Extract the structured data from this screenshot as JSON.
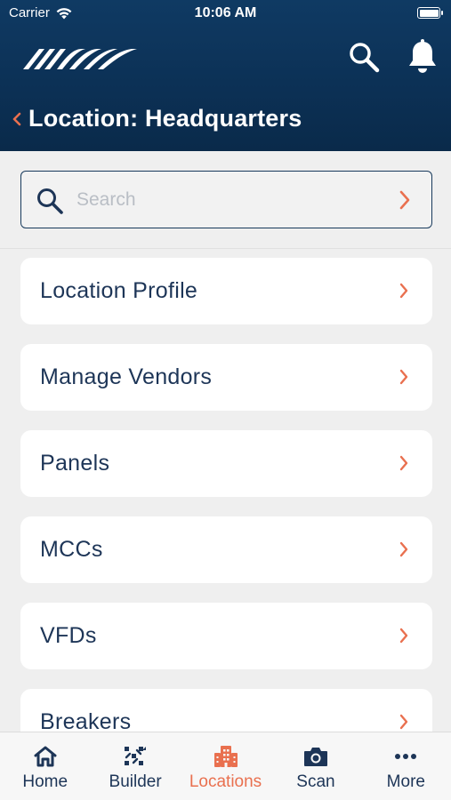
{
  "status_bar": {
    "carrier": "Carrier",
    "time": "10:06 AM"
  },
  "header": {
    "title": "Location: Headquarters",
    "icons": [
      "logo-icon",
      "search-icon",
      "bell-icon",
      "back-chevron-icon"
    ]
  },
  "search": {
    "placeholder": "Search",
    "value": ""
  },
  "menu": {
    "items": [
      {
        "label": "Location Profile"
      },
      {
        "label": "Manage Vendors"
      },
      {
        "label": "Panels"
      },
      {
        "label": "MCCs"
      },
      {
        "label": "VFDs"
      },
      {
        "label": "Breakers"
      }
    ]
  },
  "tab_bar": {
    "tabs": [
      {
        "label": "Home",
        "icon": "home-icon"
      },
      {
        "label": "Builder",
        "icon": "builder-icon"
      },
      {
        "label": "Locations",
        "icon": "building-icon",
        "active": true
      },
      {
        "label": "Scan",
        "icon": "camera-icon"
      },
      {
        "label": "More",
        "icon": "more-icon"
      }
    ]
  },
  "colors": {
    "header_bg": "#0c3156",
    "accent": "#e9704f",
    "text_primary": "#1d3557",
    "background": "#efefef",
    "card": "#ffffff"
  }
}
